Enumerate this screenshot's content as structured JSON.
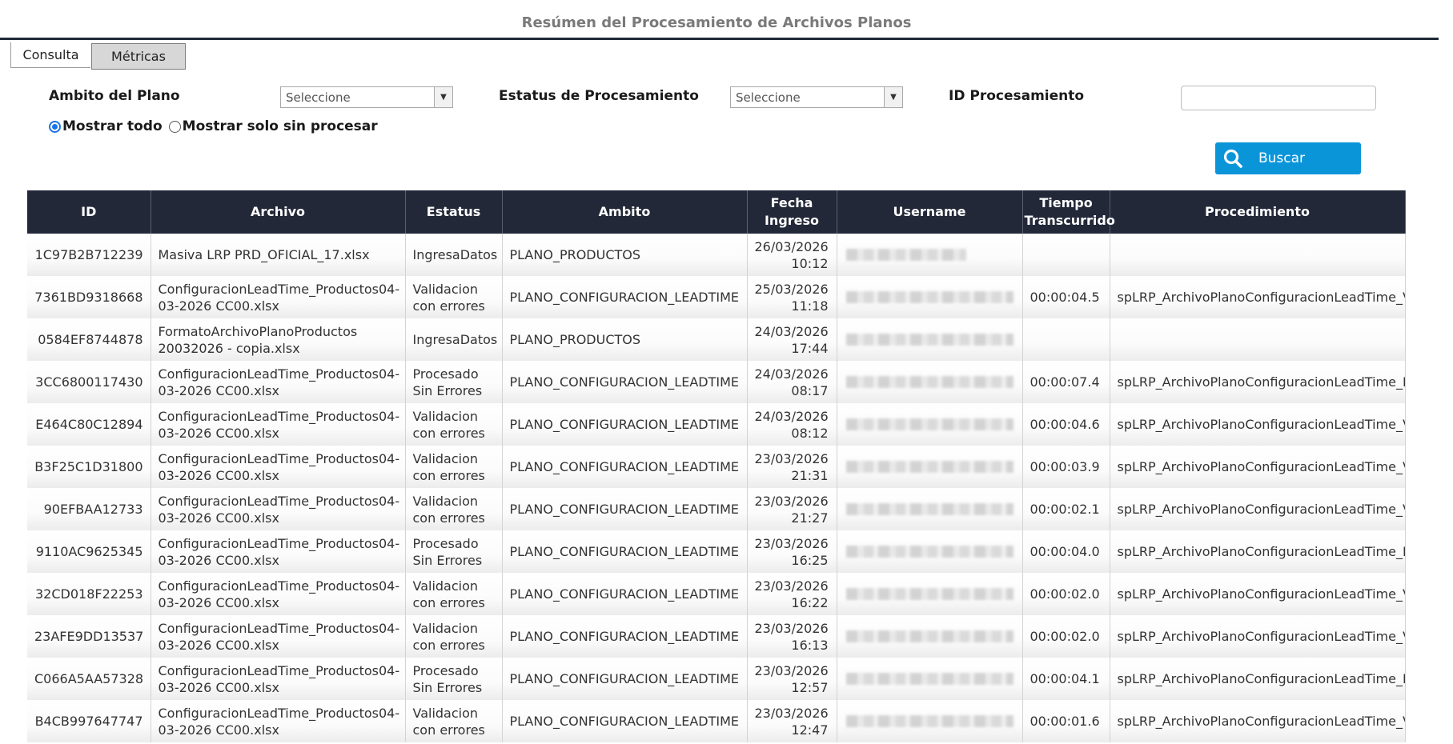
{
  "header": {
    "title": "Resúmen del Procesamiento de Archivos Planos"
  },
  "tabs": [
    {
      "label": "Consulta",
      "active": true
    },
    {
      "label": "Métricas",
      "active": false
    }
  ],
  "filters": {
    "ambito_label": "Ambito del Plano",
    "ambito_value": "Seleccione",
    "estatus_label": "Estatus de Procesamiento",
    "estatus_value": "Seleccione",
    "id_label": "ID Procesamiento",
    "id_value": "",
    "radio_all_label": "Mostrar todo",
    "radio_unprocessed_label": "Mostrar solo sin procesar",
    "selected_radio": "all",
    "search_button": "Buscar"
  },
  "table": {
    "columns": [
      "ID",
      "Archivo",
      "Estatus",
      "Ambito",
      "Fecha Ingreso",
      "Username",
      "Tiempo Transcurrido",
      "Procedimiento"
    ],
    "rows": [
      {
        "id": "1C97B2B712239",
        "archivo": "Masiva LRP PRD_OFICIAL_17.xlsx",
        "estatus": "IngresaDatos",
        "ambito": "PLANO_PRODUCTOS",
        "fecha": "26/03/2026 10:12",
        "tiempo": "",
        "procedimiento": ""
      },
      {
        "id": "7361BD9318668",
        "archivo": "ConfiguracionLeadTime_Productos04-03-2026 CC00.xlsx",
        "estatus": "Validacion con errores",
        "ambito": "PLANO_CONFIGURACION_LEADTIME",
        "fecha": "25/03/2026 11:18",
        "tiempo": "00:00:04.5",
        "procedimiento": "spLRP_ArchivoPlanoConfiguracionLeadTime_Va"
      },
      {
        "id": "0584EF8744878",
        "archivo": "FormatoArchivoPlanoProductos 20032026 - copia.xlsx",
        "estatus": "IngresaDatos",
        "ambito": "PLANO_PRODUCTOS",
        "fecha": "24/03/2026 17:44",
        "tiempo": "",
        "procedimiento": ""
      },
      {
        "id": "3CC6800117430",
        "archivo": "ConfiguracionLeadTime_Productos04-03-2026 CC00.xlsx",
        "estatus": "Procesado Sin Errores",
        "ambito": "PLANO_CONFIGURACION_LEADTIME",
        "fecha": "24/03/2026 08:17",
        "tiempo": "00:00:07.4",
        "procedimiento": "spLRP_ArchivoPlanoConfiguracionLeadTime_Pr"
      },
      {
        "id": "E464C80C12894",
        "archivo": "ConfiguracionLeadTime_Productos04-03-2026 CC00.xlsx",
        "estatus": "Validacion con errores",
        "ambito": "PLANO_CONFIGURACION_LEADTIME",
        "fecha": "24/03/2026 08:12",
        "tiempo": "00:00:04.6",
        "procedimiento": "spLRP_ArchivoPlanoConfiguracionLeadTime_Va"
      },
      {
        "id": "B3F25C1D31800",
        "archivo": "ConfiguracionLeadTime_Productos04-03-2026 CC00.xlsx",
        "estatus": "Validacion con errores",
        "ambito": "PLANO_CONFIGURACION_LEADTIME",
        "fecha": "23/03/2026 21:31",
        "tiempo": "00:00:03.9",
        "procedimiento": "spLRP_ArchivoPlanoConfiguracionLeadTime_Va"
      },
      {
        "id": "90EFBAA12733",
        "archivo": "ConfiguracionLeadTime_Productos04-03-2026 CC00.xlsx",
        "estatus": "Validacion con errores",
        "ambito": "PLANO_CONFIGURACION_LEADTIME",
        "fecha": "23/03/2026 21:27",
        "tiempo": "00:00:02.1",
        "procedimiento": "spLRP_ArchivoPlanoConfiguracionLeadTime_Va"
      },
      {
        "id": "9110AC9625345",
        "archivo": "ConfiguracionLeadTime_Productos04-03-2026 CC00.xlsx",
        "estatus": "Procesado Sin Errores",
        "ambito": "PLANO_CONFIGURACION_LEADTIME",
        "fecha": "23/03/2026 16:25",
        "tiempo": "00:00:04.0",
        "procedimiento": "spLRP_ArchivoPlanoConfiguracionLeadTime_Pr"
      },
      {
        "id": "32CD018F22253",
        "archivo": "ConfiguracionLeadTime_Productos04-03-2026 CC00.xlsx",
        "estatus": "Validacion con errores",
        "ambito": "PLANO_CONFIGURACION_LEADTIME",
        "fecha": "23/03/2026 16:22",
        "tiempo": "00:00:02.0",
        "procedimiento": "spLRP_ArchivoPlanoConfiguracionLeadTime_Va"
      },
      {
        "id": "23AFE9DD13537",
        "archivo": "ConfiguracionLeadTime_Productos04-03-2026 CC00.xlsx",
        "estatus": "Validacion con errores",
        "ambito": "PLANO_CONFIGURACION_LEADTIME",
        "fecha": "23/03/2026 16:13",
        "tiempo": "00:00:02.0",
        "procedimiento": "spLRP_ArchivoPlanoConfiguracionLeadTime_Va"
      },
      {
        "id": "C066A5AA57328",
        "archivo": "ConfiguracionLeadTime_Productos04-03-2026 CC00.xlsx",
        "estatus": "Procesado Sin Errores",
        "ambito": "PLANO_CONFIGURACION_LEADTIME",
        "fecha": "23/03/2026 12:57",
        "tiempo": "00:00:04.1",
        "procedimiento": "spLRP_ArchivoPlanoConfiguracionLeadTime_Pr"
      },
      {
        "id": "B4CB997647747",
        "archivo": "ConfiguracionLeadTime_Productos04-03-2026 CC00.xlsx",
        "estatus": "Validacion con errores",
        "ambito": "PLANO_CONFIGURACION_LEADTIME",
        "fecha": "23/03/2026 12:47",
        "tiempo": "00:00:01.6",
        "procedimiento": "spLRP_ArchivoPlanoConfiguracionLeadTime_Va"
      }
    ]
  },
  "colors": {
    "header_bg": "#222838",
    "accent": "#0b95d9",
    "title_text": "#7a7a7a"
  }
}
